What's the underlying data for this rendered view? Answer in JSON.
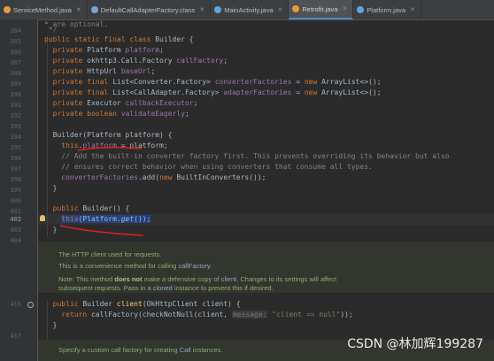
{
  "tabs": [
    {
      "label": "ServiceMethod.java",
      "color": "#e69c3c"
    },
    {
      "label": "DefaultCallAdapterFactory.class",
      "color": "#7aa3d4"
    },
    {
      "label": "MainActivity.java",
      "color": "#5ea6e0"
    },
    {
      "label": "Retrofit.java",
      "color": "#e69c3c",
      "active": true
    },
    {
      "label": "Platform.java",
      "color": "#5ea6e0"
    }
  ],
  "line_numbers": {
    "l384": "384",
    "l385": "385",
    "l386": "386",
    "l387": "387",
    "l388": "388",
    "l389": "389",
    "l390": "390",
    "l391": "391",
    "l392": "392",
    "l393": "393",
    "l394": "394",
    "l395": "395",
    "l396": "396",
    "l397": "397",
    "l398": "398",
    "l399": "399",
    "l400": "400",
    "l401": "401",
    "l402": "402",
    "l403": "403",
    "l404": "404",
    "l416": "416",
    "l417": "417"
  },
  "code": {
    "t0": "* are optional.",
    "t1": "*/",
    "t2_kw": "public static final class",
    "t2_name": " Builder {",
    "t3_kw": "private",
    "t3_type": " Platform ",
    "t3_fld": "platform",
    "t3_end": ";",
    "t4_kw": "private",
    "t4_type": " okhttp3.Call.Factory ",
    "t4_fld": "callFactory",
    "t4_end": ";",
    "t5_kw": "private",
    "t5_type": " HttpUrl ",
    "t5_fld": "baseUrl",
    "t5_end": ";",
    "t6_kw": "private final",
    "t6_type": " List<Converter.Factory> ",
    "t6_fld": "converterFactories",
    "t6_mid": " = ",
    "t6_new": "new",
    "t6_end": " ArrayList<>();",
    "t7_kw": "private final",
    "t7_type": " List<CallAdapter.Factory> ",
    "t7_fld": "adapterFactories",
    "t7_mid": " = ",
    "t7_new": "new",
    "t7_end": " ArrayList<>();",
    "t8_kw": "private",
    "t8_type": " Executor ",
    "t8_fld": "callbackExecutor",
    "t8_end": ";",
    "t9_kw": "private boolean",
    "t9_fld": " validateEagerly",
    "t9_end": ";",
    "t11_a": "Builder(Platform platform) {",
    "t12_kw": "this",
    "t12_b": ".",
    "t12_fld": "platform",
    "t12_c": " = platform;",
    "t13": "// Add the built-in converter factory first. This prevents overriding its behavior but also",
    "t14": "// ensures correct behavior when using converters that consume all types.",
    "t15_fld": "converterFactories",
    "t15_a": ".add(",
    "t15_new": "new",
    "t15_b": " BuiltInConverters());",
    "t16": "}",
    "t18_kw": "public",
    "t18_a": " Builder() {",
    "t19_kw": "this",
    "t19_a": "(Platform.",
    "t19_m": "get",
    "t19_b": "());",
    "t20": "}",
    "t30_kw": "public",
    "t30_a": " Builder ",
    "t30_m": "client",
    "t30_b": "(OkHttpClient client) {",
    "t31_kw": "return",
    "t31_a": " callFactory(checkNotNull(client, ",
    "t31_hint": "message:",
    "t31_str": " \"client == null\"",
    "t31_b": "));",
    "t32": "}"
  },
  "doc1": {
    "line1": "The HTTP client used for requests.",
    "line2a": "This is a convenience method for calling ",
    "line2b": "callFactory",
    "line2c": ".",
    "line3a": "Note: This method ",
    "line3b": "does not",
    "line3c": " make a defensive copy of ",
    "line3d": "client",
    "line3e": ". Changes to its settings will affect",
    "line4a": "subsequent requests. Pass in a ",
    "line4b": "cloned",
    "line4c": " instance to prevent this if desired."
  },
  "doc2": {
    "line1a": "Specify a custom call factory for creating ",
    "line1b": "Call",
    "line1c": " instances."
  },
  "watermark": "CSDN @林加辉199287",
  "colors": {
    "keyword": "#cc7832",
    "field": "#9876aa",
    "comment": "#808080",
    "string": "#6a8759",
    "annotation_ink": "#e02020"
  }
}
